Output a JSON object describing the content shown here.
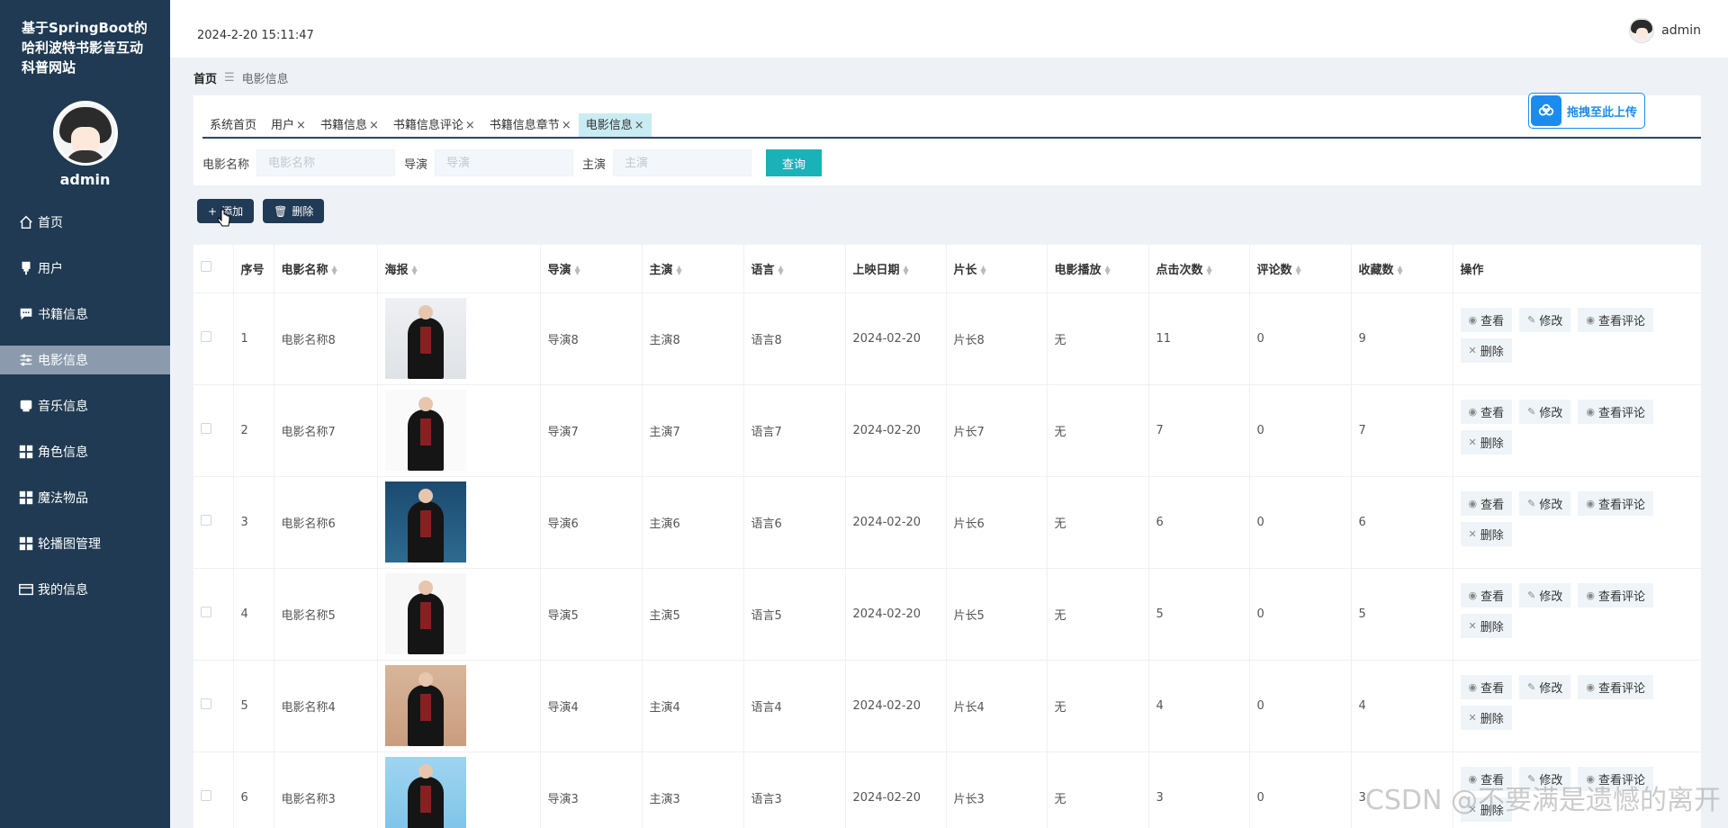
{
  "app": {
    "title": "基于SpringBoot的哈利波特书影音互动科普网站"
  },
  "sidebar": {
    "user_name": "admin",
    "items": [
      {
        "label": "首页",
        "icon": "home-icon"
      },
      {
        "label": "用户",
        "icon": "user-icon"
      },
      {
        "label": "书籍信息",
        "icon": "chat-icon"
      },
      {
        "label": "电影信息",
        "icon": "sliders-icon",
        "active": true
      },
      {
        "label": "音乐信息",
        "icon": "music-icon"
      },
      {
        "label": "角色信息",
        "icon": "grid-icon"
      },
      {
        "label": "魔法物品",
        "icon": "grid-icon"
      },
      {
        "label": "轮播图管理",
        "icon": "grid-icon"
      },
      {
        "label": "我的信息",
        "icon": "card-icon"
      }
    ]
  },
  "header": {
    "datetime": "2024-2-20 15:11:47",
    "user_name": "admin"
  },
  "breadcrumb": {
    "home": "首页",
    "current": "电影信息"
  },
  "tabs": [
    {
      "label": "系统首页",
      "closable": false
    },
    {
      "label": "用户",
      "closable": true
    },
    {
      "label": "书籍信息",
      "closable": true
    },
    {
      "label": "书籍信息评论",
      "closable": true
    },
    {
      "label": "书籍信息章节",
      "closable": true
    },
    {
      "label": "电影信息",
      "closable": true,
      "active": true
    }
  ],
  "upload": {
    "label": "拖拽至此上传"
  },
  "search": {
    "fields": [
      {
        "label": "电影名称",
        "placeholder": "电影名称",
        "value": ""
      },
      {
        "label": "导演",
        "placeholder": "导演",
        "value": ""
      },
      {
        "label": "主演",
        "placeholder": "主演",
        "value": ""
      }
    ],
    "query_label": "查询"
  },
  "toolbar": {
    "add_label": "添加",
    "delete_label": "删除"
  },
  "table": {
    "columns": [
      "序号",
      "电影名称",
      "海报",
      "导演",
      "主演",
      "语言",
      "上映日期",
      "片长",
      "电影播放",
      "点击次数",
      "评论数",
      "收藏数",
      "操作"
    ],
    "rows": [
      {
        "index": "1",
        "name": "电影名称8",
        "director": "导演8",
        "actor": "主演8",
        "language": "语言8",
        "date": "2024-02-20",
        "duration": "片长8",
        "play": "无",
        "clicks": "11",
        "comments": "0",
        "favorites": "9"
      },
      {
        "index": "2",
        "name": "电影名称7",
        "director": "导演7",
        "actor": "主演7",
        "language": "语言7",
        "date": "2024-02-20",
        "duration": "片长7",
        "play": "无",
        "clicks": "7",
        "comments": "0",
        "favorites": "7"
      },
      {
        "index": "3",
        "name": "电影名称6",
        "director": "导演6",
        "actor": "主演6",
        "language": "语言6",
        "date": "2024-02-20",
        "duration": "片长6",
        "play": "无",
        "clicks": "6",
        "comments": "0",
        "favorites": "6"
      },
      {
        "index": "4",
        "name": "电影名称5",
        "director": "导演5",
        "actor": "主演5",
        "language": "语言5",
        "date": "2024-02-20",
        "duration": "片长5",
        "play": "无",
        "clicks": "5",
        "comments": "0",
        "favorites": "5"
      },
      {
        "index": "5",
        "name": "电影名称4",
        "director": "导演4",
        "actor": "主演4",
        "language": "语言4",
        "date": "2024-02-20",
        "duration": "片长4",
        "play": "无",
        "clicks": "4",
        "comments": "0",
        "favorites": "4"
      },
      {
        "index": "6",
        "name": "电影名称3",
        "director": "导演3",
        "actor": "主演3",
        "language": "语言3",
        "date": "2024-02-20",
        "duration": "片长3",
        "play": "无",
        "clicks": "3",
        "comments": "0",
        "favorites": "3"
      }
    ],
    "ops": {
      "view": "查看",
      "edit": "修改",
      "view_comments": "查看评论",
      "delete": "删除"
    }
  },
  "watermark": "CSDN @不要满是遗憾的离开"
}
